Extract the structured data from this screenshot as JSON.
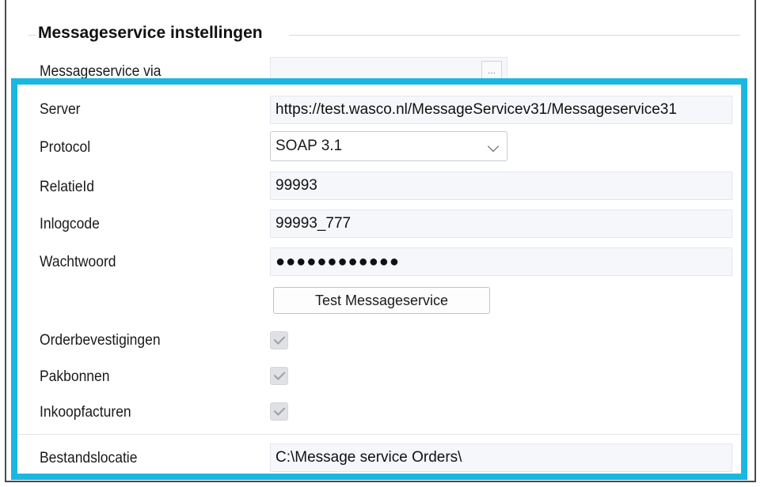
{
  "group": {
    "title": "Messageservice instellingen"
  },
  "fields": {
    "messageservice_via": {
      "label": "Messageservice via",
      "value": "",
      "button_label": "..."
    },
    "server": {
      "label": "Server",
      "value": "https://test.wasco.nl/MessageServicev31/Messageservice31"
    },
    "protocol": {
      "label": "Protocol",
      "value": "SOAP 3.1"
    },
    "relatieid": {
      "label": "RelatieId",
      "value": "99993"
    },
    "inlogcode": {
      "label": "Inlogcode",
      "value": "99993_777"
    },
    "wachtwoord": {
      "label": "Wachtwoord",
      "value": "●●●●●●●●●●●●"
    },
    "test_button": {
      "label": "Test Messageservice"
    },
    "orderbevestigingen": {
      "label": "Orderbevestigingen",
      "checked": true
    },
    "pakbonnen": {
      "label": "Pakbonnen",
      "checked": true
    },
    "inkoopfacturen": {
      "label": "Inkoopfacturen",
      "checked": true
    },
    "bestandslocatie": {
      "label": "Bestandslocatie",
      "value": "C:\\Message service Orders\\"
    }
  },
  "colors": {
    "highlight": "#1ab7e0",
    "field_bg": "#f5f7fb"
  }
}
